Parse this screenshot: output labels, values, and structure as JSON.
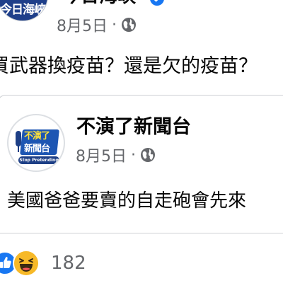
{
  "outer_post": {
    "page_name": "今日海峽",
    "avatar_logo_text": "今日海峽",
    "date": "8月5日",
    "separator": "·",
    "privacy_icon": "globe-icon",
    "verified_icon": "verified-badge-icon",
    "text": "買武器換疫苗？還是欠的疫苗？"
  },
  "shared_post": {
    "page_name": "不演了新聞台",
    "avatar_logo_text_top": "不演了",
    "avatar_logo_text_bottom": "新聞台",
    "avatar_ribbon_text": "Stop Pretending",
    "date": "8月5日",
    "separator": "·",
    "privacy_icon": "globe-icon",
    "text": "美國爸爸要賣的自走砲會先來"
  },
  "reactions": {
    "icons": [
      "like-reaction-icon",
      "haha-reaction-icon"
    ],
    "count": "182"
  },
  "colors": {
    "facebook_blue": "#1877f2",
    "secondary_text": "#65676b",
    "primary_text": "#050505",
    "haha_yellow": "#f7b928",
    "divider": "#ced0d4"
  }
}
